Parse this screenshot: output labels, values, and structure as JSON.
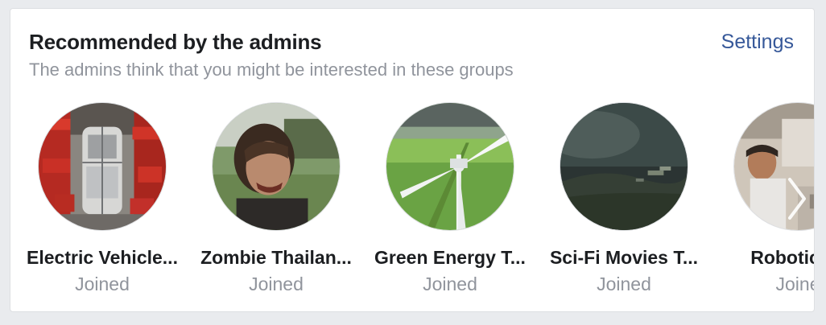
{
  "header": {
    "title": "Recommended by the admins",
    "subtitle": "The admins think that you might be interested in these groups",
    "settings_label": "Settings"
  },
  "groups": [
    {
      "name": "Electric Vehicle...",
      "status": "Joined",
      "image": "car-factory-robots-photo"
    },
    {
      "name": "Zombie Thailan...",
      "status": "Joined",
      "image": "zombie-man-photo"
    },
    {
      "name": "Green Energy T...",
      "status": "Joined",
      "image": "wind-turbine-photo"
    },
    {
      "name": "Sci-Fi Movies T...",
      "status": "Joined",
      "image": "alien-landscape-photo"
    },
    {
      "name": "Robotics a",
      "status": "Joine",
      "image": "robotics-scientist-photo"
    }
  ],
  "carousel": {
    "next_icon": "chevron-right-icon"
  },
  "colors": {
    "link": "#365899",
    "muted": "#90949c",
    "text": "#1c1e21",
    "background": "#e9ebee"
  }
}
